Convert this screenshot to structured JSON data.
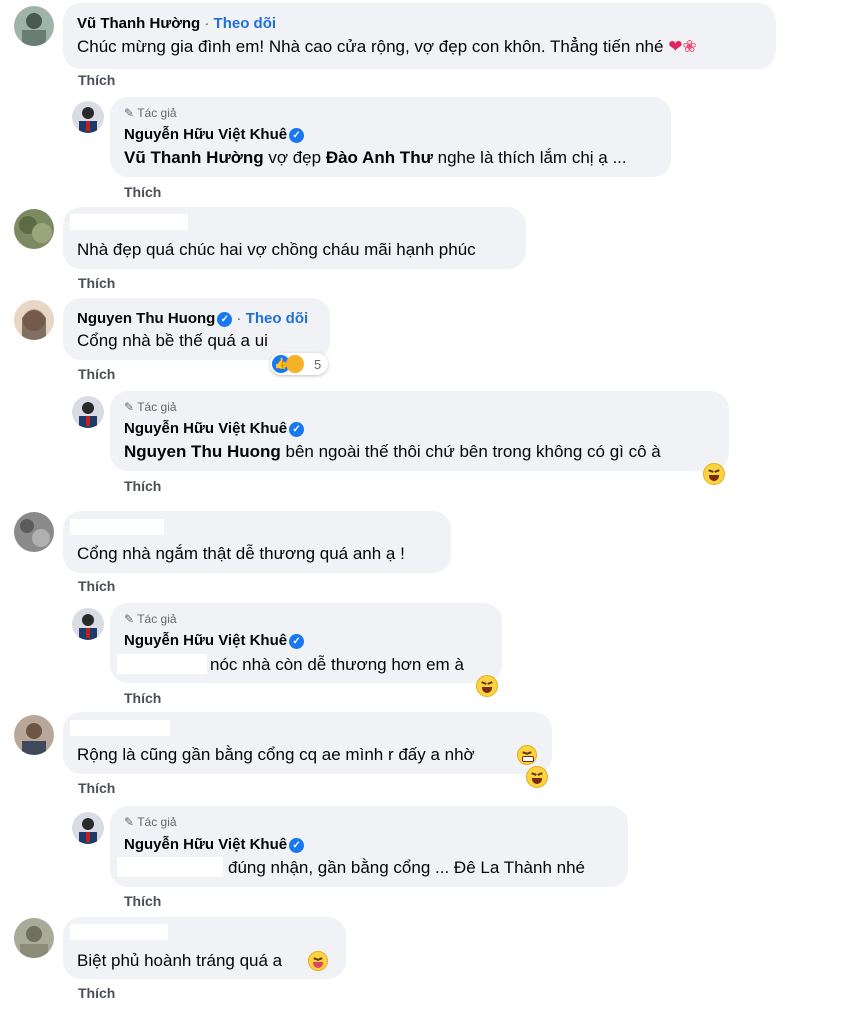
{
  "like_label": "Thích",
  "follow_label": "Theo dõi",
  "author_badge": "Tác giả",
  "comments": [
    {
      "name": "Vũ Thanh Hường",
      "text": "Chúc mừng gia đình em! Nhà cao cửa rộng, vợ đẹp con khôn. Thẳng tiến nhé",
      "reply": {
        "name": "Nguyễn Hữu Việt Khuê",
        "mention1": "Vũ Thanh Hường",
        "mid": "vợ đẹp",
        "mention2": "Đào Anh Thư",
        "text": "nghe là thích lắm chị ạ ..."
      }
    },
    {
      "text": "Nhà đẹp quá chúc hai vợ chồng cháu mãi hạnh phúc"
    },
    {
      "name": "Nguyen Thu Huong",
      "text": "Cổng nhà bề thế quá a ui",
      "reaction_count": "5",
      "reply": {
        "name": "Nguyễn Hữu Việt Khuê",
        "mention": "Nguyen Thu Huong",
        "text": "bên ngoài thế thôi chứ bên trong không có gì cô à"
      }
    },
    {
      "text": "Cổng nhà ngắm thật dễ thương quá anh ạ !",
      "reply": {
        "name": "Nguyễn Hữu Việt Khuê",
        "text": "nóc nhà còn dễ thương hơn em à"
      }
    },
    {
      "text": "Rộng là cũng gần bằng cổng cq ae mình r đấy a nhờ",
      "reply": {
        "name": "Nguyễn Hữu Việt Khuê",
        "text": "đúng nhận, gần bằng cổng ... Đê La Thành nhé"
      }
    },
    {
      "text": "Biệt phủ hoành tráng quá a"
    }
  ]
}
